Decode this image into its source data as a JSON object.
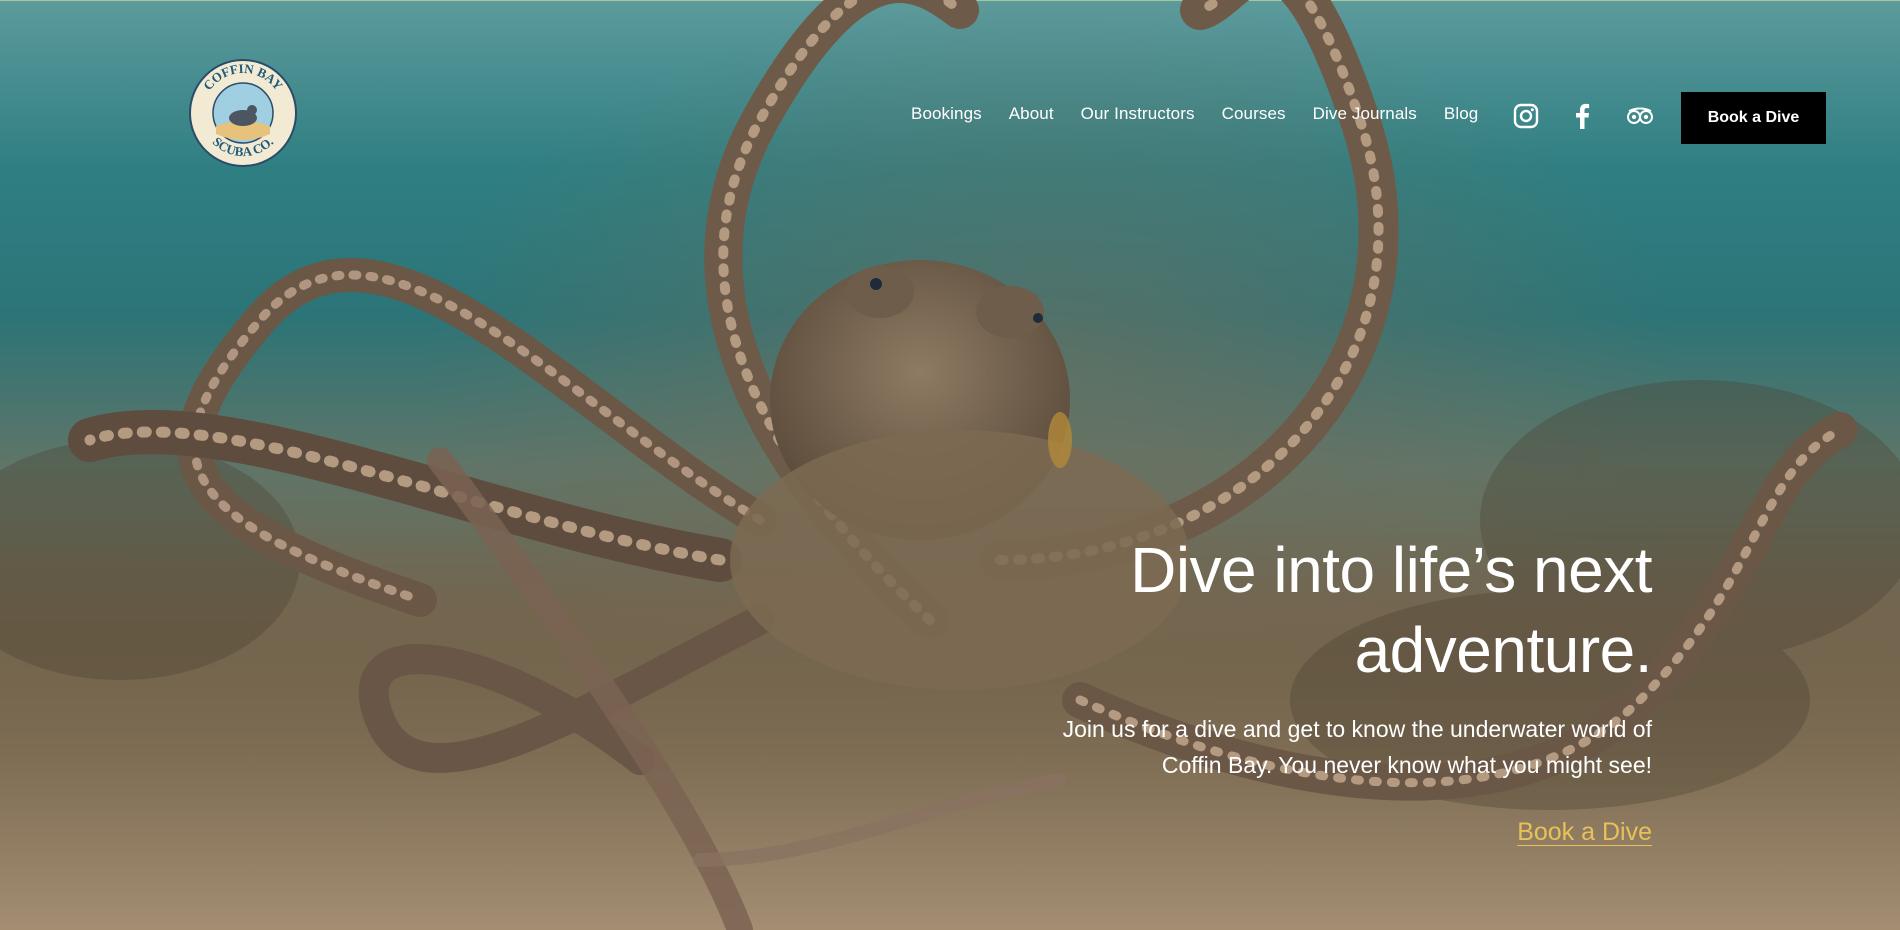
{
  "brand": {
    "logo_top_text": "COFFIN BAY",
    "logo_bottom_text": "SCUBA CO."
  },
  "nav": {
    "items": [
      {
        "label": "Bookings"
      },
      {
        "label": "About"
      },
      {
        "label": "Our Instructors"
      },
      {
        "label": "Courses"
      },
      {
        "label": "Dive Journals"
      },
      {
        "label": "Blog"
      }
    ],
    "social_icons": [
      "instagram-icon",
      "facebook-icon",
      "tripadvisor-icon"
    ],
    "cta_label": "Book a Dive"
  },
  "hero": {
    "headline_line1": "Dive into life’s next",
    "headline_line2": "adventure.",
    "subtext_line1": "Join us for a dive and get to know the underwater world of",
    "subtext_line2": "Coffin Bay. You never know what you might see!",
    "link_label": "Book a Dive"
  },
  "colors": {
    "button_bg": "#000000",
    "link_accent": "#e9c15a",
    "water": "#2c7477",
    "sand": "#746650"
  }
}
